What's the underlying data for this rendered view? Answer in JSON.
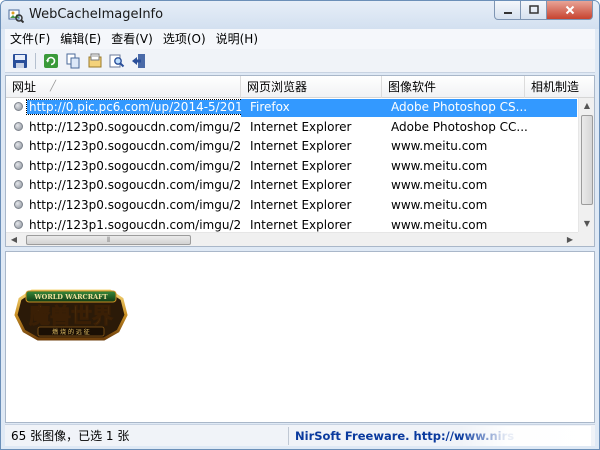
{
  "window": {
    "title": "WebCacheImageInfo"
  },
  "menu": [
    {
      "label": "文件(F)"
    },
    {
      "label": "编辑(E)"
    },
    {
      "label": "查看(V)"
    },
    {
      "label": "选项(O)"
    },
    {
      "label": "说明(H)"
    }
  ],
  "toolbar": [
    {
      "icon": "save-icon"
    },
    {
      "icon": "refresh-icon"
    },
    {
      "icon": "copy-icon"
    },
    {
      "icon": "properties-icon"
    },
    {
      "icon": "search-icon"
    },
    {
      "icon": "exit-icon"
    }
  ],
  "table": {
    "columns": [
      {
        "label": "网址"
      },
      {
        "label": "网页浏览器"
      },
      {
        "label": "图像软件"
      },
      {
        "label": "相机制造"
      }
    ],
    "rows": [
      {
        "url": "http://0.pic.pc6.com/up/2014-5/2014...",
        "browser": "Firefox",
        "software": "Adobe Photoshop CS...",
        "selected": true
      },
      {
        "url": "http://123p0.sogoucdn.com/imgu/20...",
        "browser": "Internet Explorer",
        "software": "Adobe Photoshop CC...",
        "selected": false
      },
      {
        "url": "http://123p0.sogoucdn.com/imgu/20...",
        "browser": "Internet Explorer",
        "software": "www.meitu.com",
        "selected": false
      },
      {
        "url": "http://123p0.sogoucdn.com/imgu/20...",
        "browser": "Internet Explorer",
        "software": "www.meitu.com",
        "selected": false
      },
      {
        "url": "http://123p0.sogoucdn.com/imgu/20...",
        "browser": "Internet Explorer",
        "software": "www.meitu.com",
        "selected": false
      },
      {
        "url": "http://123p0.sogoucdn.com/imgu/20...",
        "browser": "Internet Explorer",
        "software": "www.meitu.com",
        "selected": false
      },
      {
        "url": "http://123p1.sogoucdn.com/imgu/20...",
        "browser": "Internet Explorer",
        "software": "www.meitu.com",
        "selected": false
      }
    ]
  },
  "preview": {
    "logo_top": "WORLD WARCRAFT",
    "logo_main": "魔兽世界",
    "logo_sub": "燃 烧 的 远 征"
  },
  "status": {
    "count": "65 张图像，已选 1 张",
    "credit": "NirSoft Freeware.  http://www.nirs"
  },
  "colors": {
    "selection": "#3399ff",
    "credit_text": "#0a3a9e"
  }
}
